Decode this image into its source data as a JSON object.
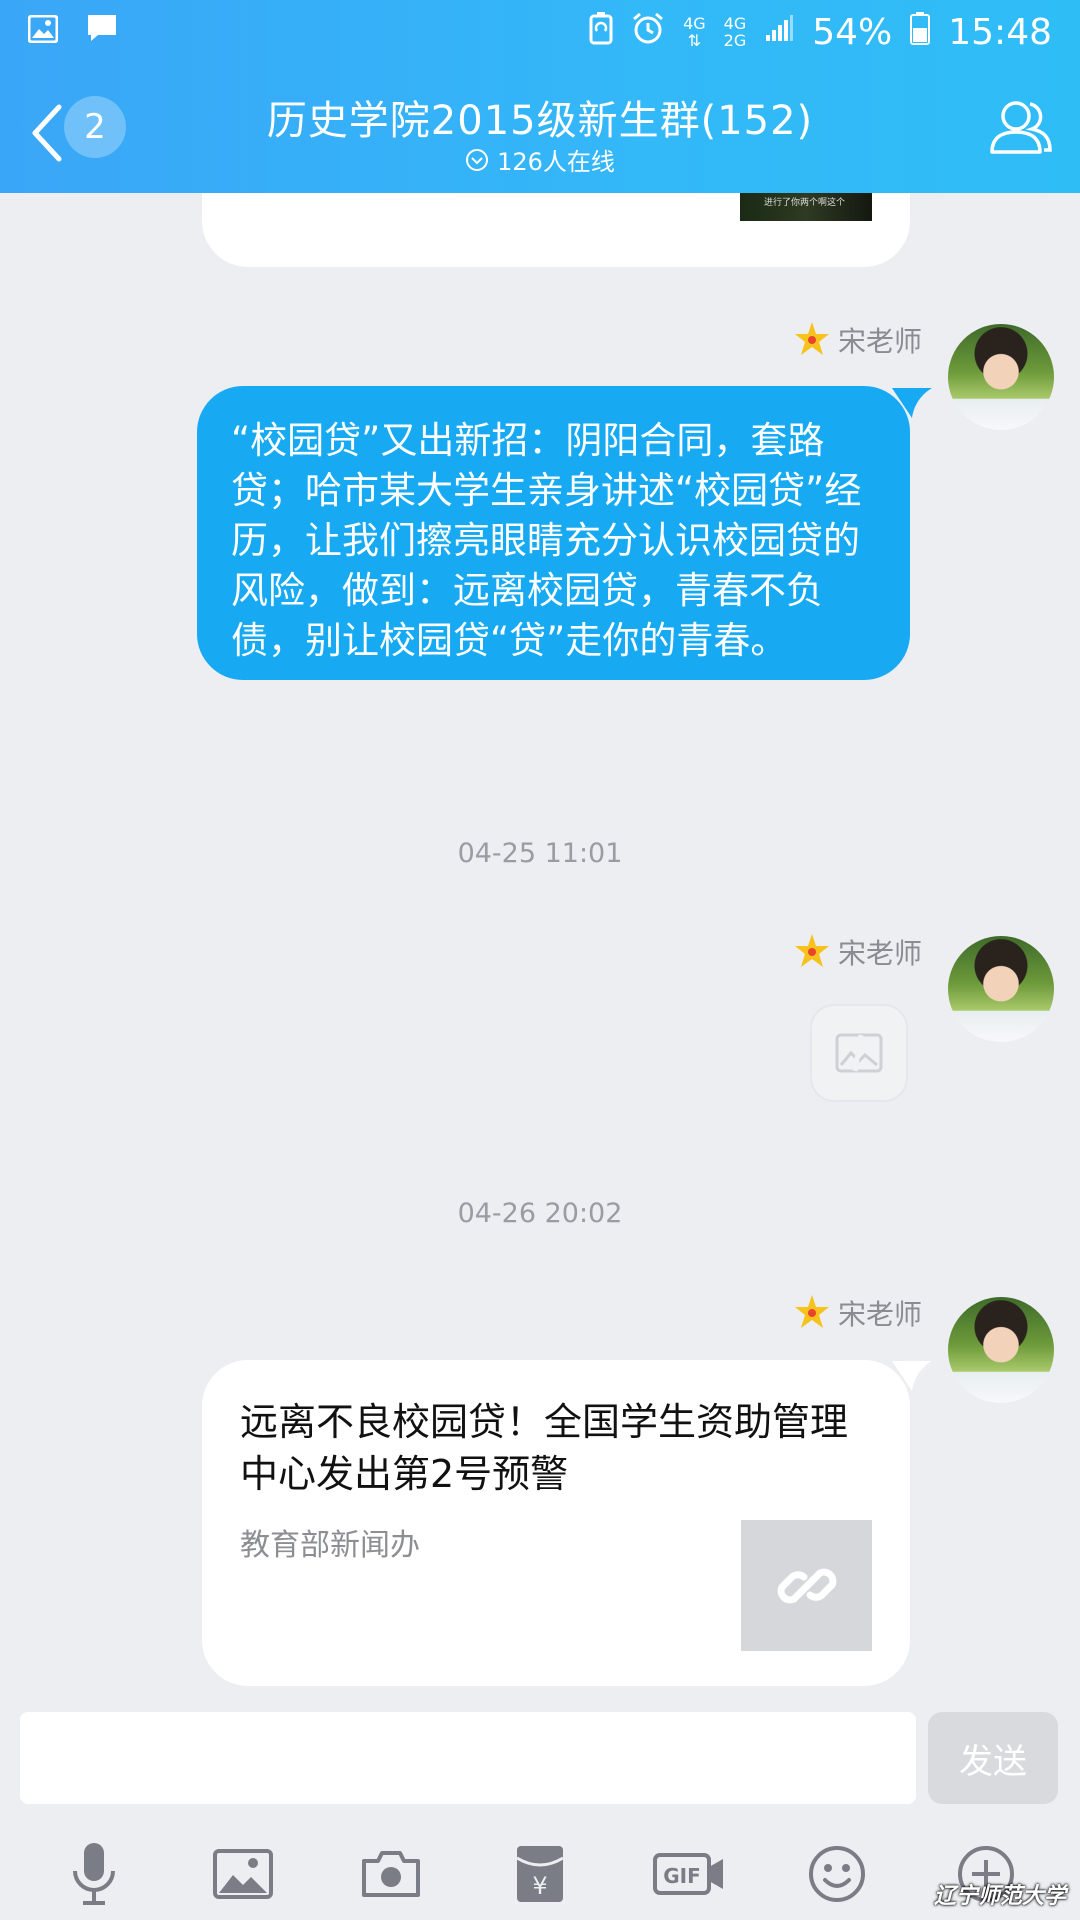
{
  "status_bar": {
    "network_top": "4G",
    "network_2_top": "4G",
    "network_2_bottom": "2G",
    "battery": "54%",
    "time": "15:48"
  },
  "header": {
    "unread_count": "2",
    "title": "历史学院2015级新生群(152)",
    "online": "126人在线"
  },
  "messages": {
    "partial_video_caption": "进行了你两个啊这个",
    "sender": "宋老师",
    "msg1_text": "“校园贷”又出新招：阴阳合同，套路贷；哈市某大学生亲身讲述“校园贷”经历，让我们擦亮眼睛充分认识校园贷的风险，做到：远离校园贷，青春不负债，别让校园贷“贷”走你的青春。",
    "timestamp1": "04-25 11:01",
    "timestamp2": "04-26 20:02",
    "link_title": "远离不良校园贷！全国学生资助管理中心发出第2号预警",
    "link_source": "教育部新闻办"
  },
  "input": {
    "value": "",
    "send_label": "发送"
  },
  "toolbar_icons": [
    "microphone-icon",
    "image-icon",
    "camera-icon",
    "red-packet-icon",
    "gif-icon",
    "emoji-icon",
    "plus-icon"
  ],
  "watermark": "辽宁师范大学",
  "colors": {
    "header_gradient_start": "#3aa6f7",
    "header_gradient_end": "#2fbdf6",
    "bubble_blue": "#17aaf3",
    "background": "#edeef2"
  }
}
